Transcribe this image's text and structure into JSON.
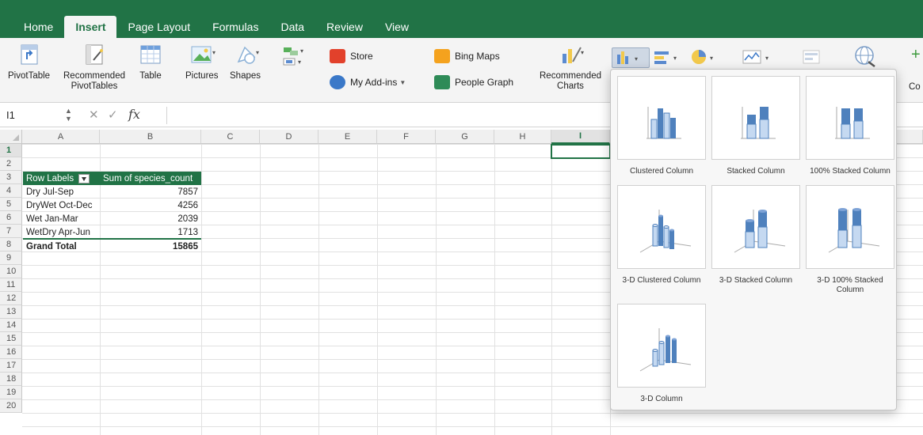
{
  "ribbon_tabs": [
    "Home",
    "Insert",
    "Page Layout",
    "Formulas",
    "Data",
    "Review",
    "View"
  ],
  "active_tab": "Insert",
  "ribbon": {
    "pivot_table": "PivotTable",
    "rec_pivot_line1": "Recommended",
    "rec_pivot_line2": "PivotTables",
    "table": "Table",
    "pictures": "Pictures",
    "shapes": "Shapes",
    "store": "Store",
    "my_addins": "My Add-ins",
    "bing_maps": "Bing Maps",
    "people_graph": "People Graph",
    "rec_charts_line1": "Recommended",
    "rec_charts_line2": "Charts",
    "cut_off_label": "Co"
  },
  "formula_bar": {
    "name_box": "I1",
    "fx": "fx",
    "formula": ""
  },
  "columns": [
    "A",
    "B",
    "C",
    "D",
    "E",
    "F",
    "G",
    "H",
    "I"
  ],
  "rows": [
    "1",
    "2",
    "3",
    "4",
    "5",
    "6",
    "7",
    "8",
    "9",
    "10",
    "11",
    "12",
    "13",
    "14",
    "15",
    "16",
    "17",
    "18",
    "19",
    "20"
  ],
  "selected_cell": {
    "column": "I",
    "row": "1"
  },
  "pivot": {
    "header_labels": "Row Labels",
    "header_values": "Sum of species_count",
    "rows": [
      {
        "label": "Dry Jul-Sep",
        "value": "7857"
      },
      {
        "label": "DryWet Oct-Dec",
        "value": "4256"
      },
      {
        "label": "Wet Jan-Mar",
        "value": "2039"
      },
      {
        "label": "WetDry Apr-Jun",
        "value": "1713"
      }
    ],
    "total_label": "Grand Total",
    "total_value": "15865"
  },
  "chart_menu": {
    "items": [
      {
        "label": "Clustered Column",
        "icon": "clustered-column-icon"
      },
      {
        "label": "Stacked Column",
        "icon": "stacked-column-icon"
      },
      {
        "label": "100% Stacked Column",
        "icon": "100-stacked-column-icon"
      },
      {
        "label": "3-D Clustered Column",
        "icon": "3d-clustered-column-icon"
      },
      {
        "label": "3-D Stacked Column",
        "icon": "3d-stacked-column-icon"
      },
      {
        "label": "3-D 100% Stacked Column",
        "icon": "3d-100-stacked-column-icon"
      },
      {
        "label": "3-D Column",
        "icon": "3d-column-icon"
      }
    ]
  },
  "colors": {
    "excel_green": "#217346",
    "column_blue": "#4f81bd",
    "column_light": "#c5d9f1"
  }
}
